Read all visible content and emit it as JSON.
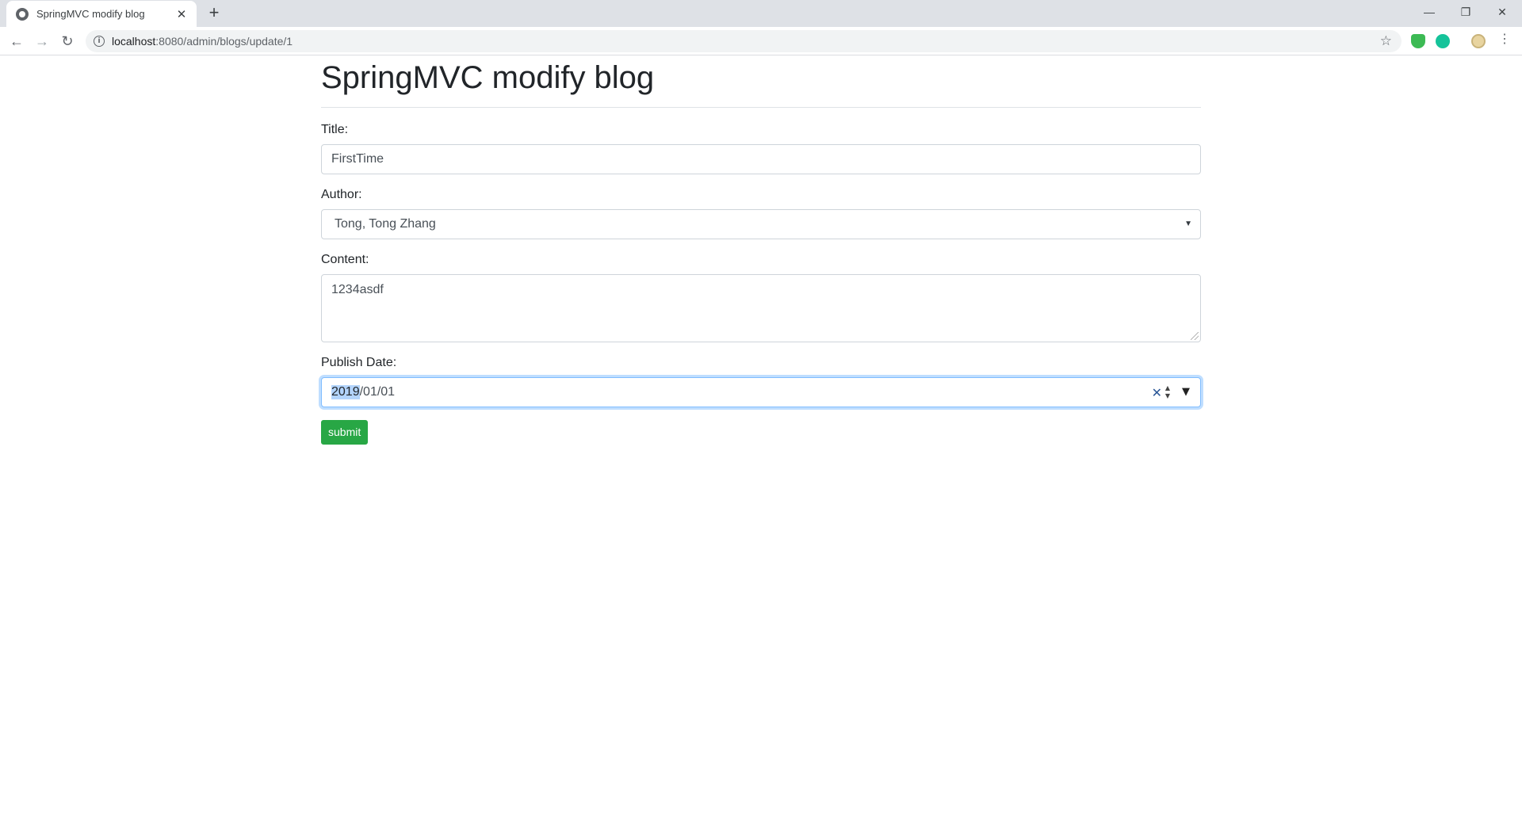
{
  "browser": {
    "tab_title": "SpringMVC modify blog",
    "tab_close": "✕",
    "new_tab": "+",
    "url_host": "localhost",
    "url_rest": ":8080/admin/blogs/update/1",
    "window_controls": {
      "minimize": "—",
      "restore": "❐",
      "close": "✕"
    },
    "nav": {
      "back": "←",
      "forward": "→",
      "reload": "↻"
    }
  },
  "page": {
    "title": "SpringMVC modify blog",
    "fields": {
      "title_label": "Title:",
      "title_value": "FirstTime",
      "author_label": "Author:",
      "author_value": "Tong, Tong Zhang",
      "content_label": "Content:",
      "content_value": "1234asdf",
      "date_label": "Publish Date:",
      "date_year": "2019",
      "date_rest": "/01/01"
    },
    "submit_label": "submit"
  },
  "colors": {
    "submit": "#28a745",
    "focus_border": "#80bdff",
    "selection": "#b3d4fc"
  }
}
